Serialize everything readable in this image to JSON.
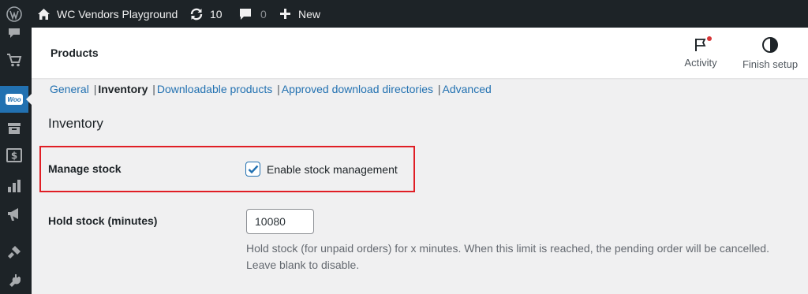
{
  "adminbar": {
    "wp_logo": "wordpress-logo",
    "site_name": "WC Vendors Playground",
    "updates_count": "10",
    "comments_count": "0",
    "new_label": "New"
  },
  "sidebar": {
    "woo_label": "Woo"
  },
  "header": {
    "title": "Products",
    "activity_label": "Activity",
    "finish_setup_label": "Finish setup"
  },
  "subtabs": [
    {
      "label": "General",
      "current": false
    },
    {
      "label": "Inventory",
      "current": true
    },
    {
      "label": "Downloadable products",
      "current": false
    },
    {
      "label": "Approved download directories",
      "current": false
    },
    {
      "label": "Advanced",
      "current": false
    }
  ],
  "section": {
    "title": "Inventory"
  },
  "manage_stock": {
    "label": "Manage stock",
    "checkbox_label": "Enable stock management",
    "checked": true
  },
  "hold_stock": {
    "label": "Hold stock (minutes)",
    "value": "10080",
    "description": "Hold stock (for unpaid orders) for x minutes. When this limit is reached, the pending order will be cancelled. Leave blank to disable."
  },
  "colors": {
    "adminbar_bg": "#1d2327",
    "accent": "#2271b1",
    "highlight_border": "#e01e25",
    "notification_dot": "#d63638"
  }
}
